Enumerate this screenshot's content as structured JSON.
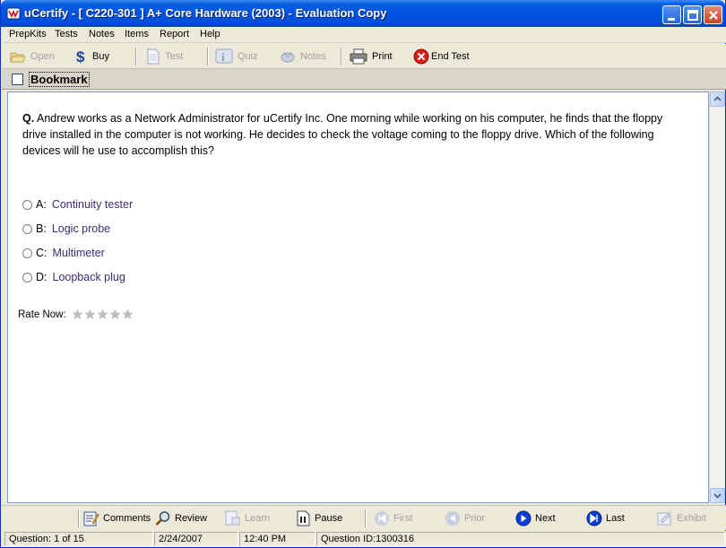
{
  "window": {
    "title": "uCertify - [ C220-301 ] A+ Core Hardware (2003) - Evaluation Copy"
  },
  "menu": [
    "PrepKits",
    "Tests",
    "Notes",
    "Items",
    "Report",
    "Help"
  ],
  "toolbar": {
    "open": "Open",
    "buy": "Buy",
    "test": "Test",
    "quiz": "Quiz",
    "notes": "Notes",
    "print": "Print",
    "end_test": "End Test"
  },
  "bookmark": {
    "label": "Bookmark",
    "checked": false
  },
  "question": {
    "prefix": "Q.",
    "text": "Andrew works as a Network Administrator for uCertify Inc. One morning while working on his computer, he finds that the floppy drive installed in the computer is not working. He decides to check the voltage coming to the floppy drive. Which of the following devices will he use to accomplish this?",
    "options": [
      {
        "letter": "A:",
        "text": "Continuity tester"
      },
      {
        "letter": "B:",
        "text": "Logic probe"
      },
      {
        "letter": "C:",
        "text": "Multimeter"
      },
      {
        "letter": "D:",
        "text": "Loopback plug"
      }
    ]
  },
  "rating": {
    "label": "Rate Now:",
    "value": 0,
    "max": 5
  },
  "nav": {
    "comments": "Comments",
    "review": "Review",
    "learn": "Learn",
    "pause": "Pause",
    "first": "First",
    "prior": "Prior",
    "next": "Next",
    "last": "Last",
    "exhibit": "Exhibit"
  },
  "status": {
    "question": "Question: 1 of 15",
    "date": "2/24/2007",
    "time": "12:40 PM",
    "question_id": "Question ID:1300316"
  },
  "colors": {
    "titlebar": "#0054E3",
    "option_text": "#3E2A7A",
    "disabled_text": "#A0A0A0",
    "nav_blue": "#0A3FD6",
    "end_test_red": "#D91E18"
  }
}
